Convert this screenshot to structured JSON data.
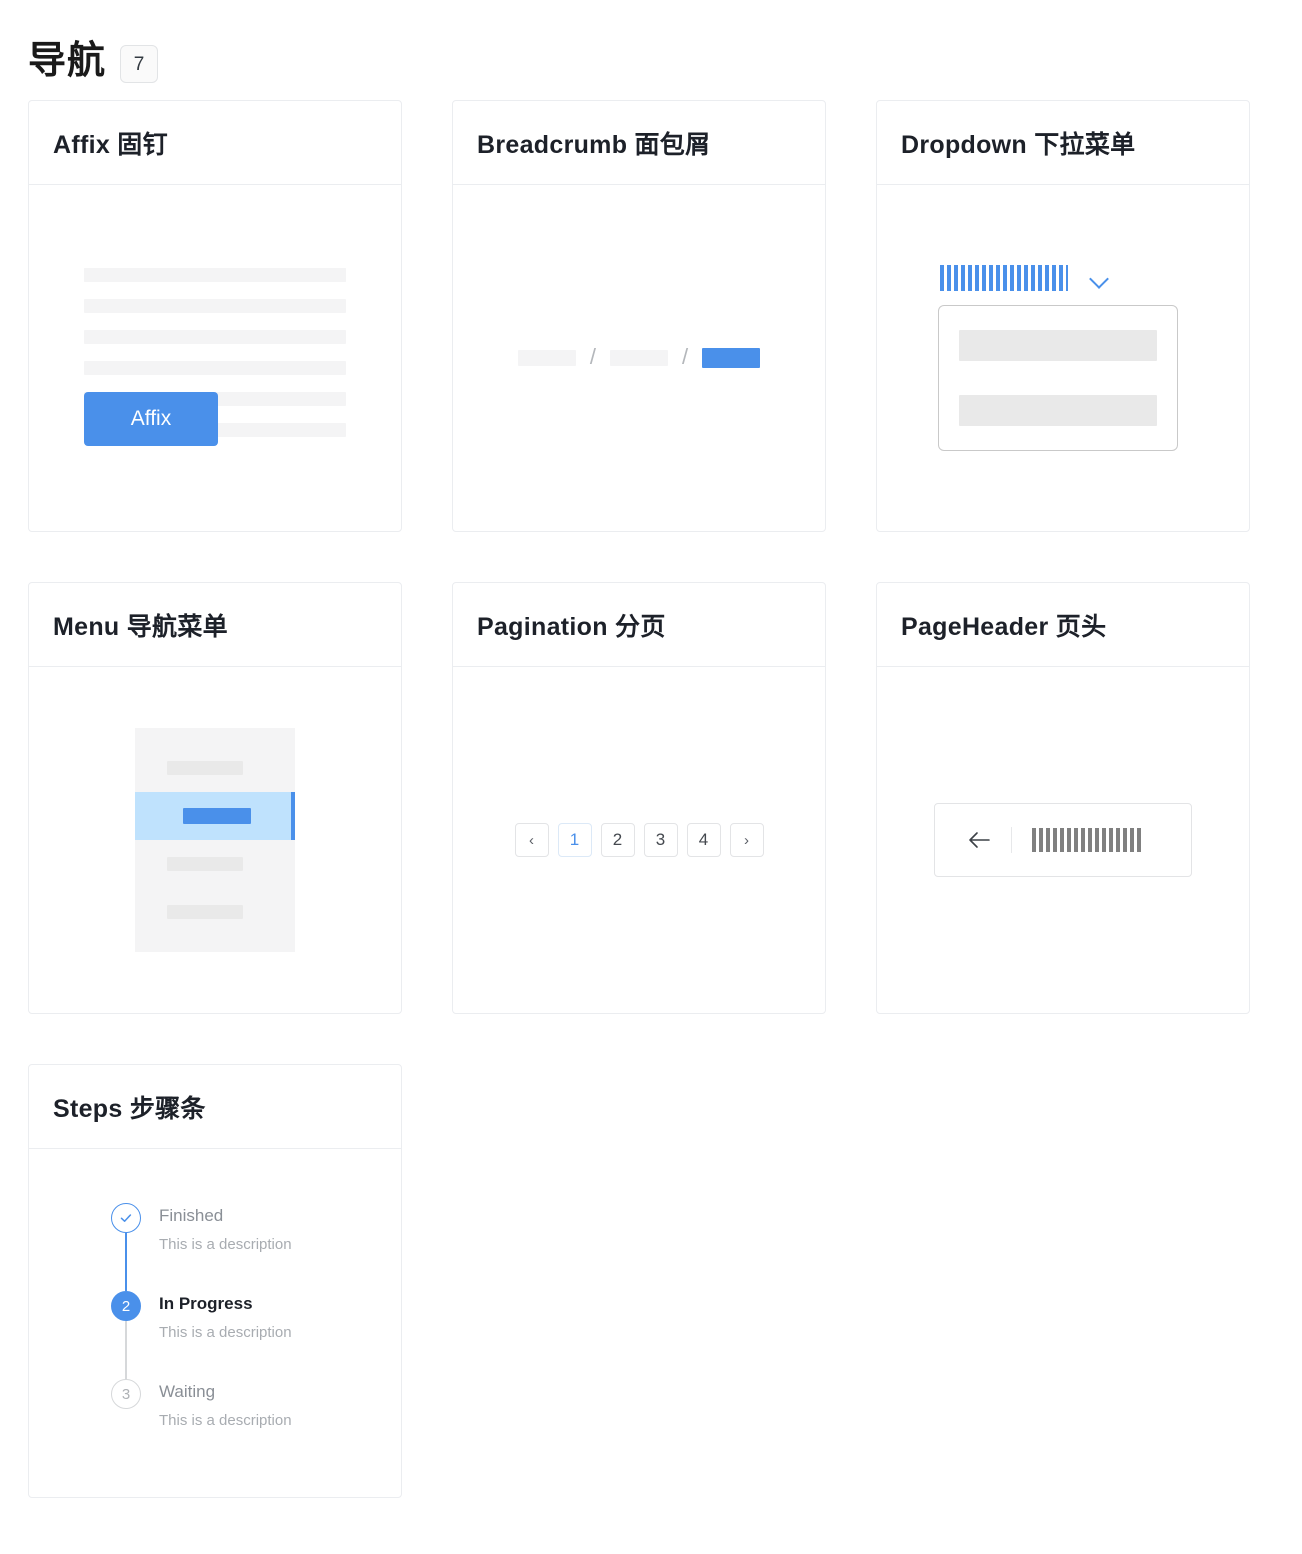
{
  "header": {
    "title": "导航",
    "count": "7"
  },
  "colors": {
    "primary": "#4a90ea",
    "primary_light": "#bfe2fd",
    "skeleton": "#f4f4f5",
    "skeleton_dark": "#e9e9e9",
    "border": "#ebedf0",
    "text": "#1d2129",
    "text_muted": "#8a8f96"
  },
  "cards": [
    {
      "key": "affix",
      "title": "Affix 固钉",
      "button_label": "Affix",
      "skeleton_line_count": 6
    },
    {
      "key": "breadcrumb",
      "title": "Breadcrumb 面包屑",
      "separator": "/",
      "items": [
        {
          "label": "",
          "state": "default"
        },
        {
          "label": "",
          "state": "default"
        },
        {
          "label": "",
          "state": "active"
        }
      ]
    },
    {
      "key": "dropdown",
      "title": "Dropdown 下拉菜单",
      "trigger_label": "",
      "chevron": "chevron-down",
      "menu_items": [
        "",
        ""
      ]
    },
    {
      "key": "menu",
      "title": "Menu 导航菜单",
      "items": [
        {
          "label": "",
          "selected": false
        },
        {
          "label": "",
          "selected": true
        },
        {
          "label": "",
          "selected": false
        },
        {
          "label": "",
          "selected": false
        }
      ]
    },
    {
      "key": "pagination",
      "title": "Pagination 分页",
      "prev": "‹",
      "next": "›",
      "pages": [
        "1",
        "2",
        "3",
        "4"
      ],
      "current_page": "1"
    },
    {
      "key": "pageheader",
      "title": "PageHeader 页头",
      "back_icon": "arrow-left",
      "page_title": ""
    },
    {
      "key": "steps",
      "title": "Steps 步骤条",
      "steps": [
        {
          "index": "✓",
          "title": "Finished",
          "description": "This is a description",
          "status": "finish"
        },
        {
          "index": "2",
          "title": "In Progress",
          "description": "This is a description",
          "status": "process"
        },
        {
          "index": "3",
          "title": "Waiting",
          "description": "This is a description",
          "status": "wait"
        }
      ]
    }
  ]
}
